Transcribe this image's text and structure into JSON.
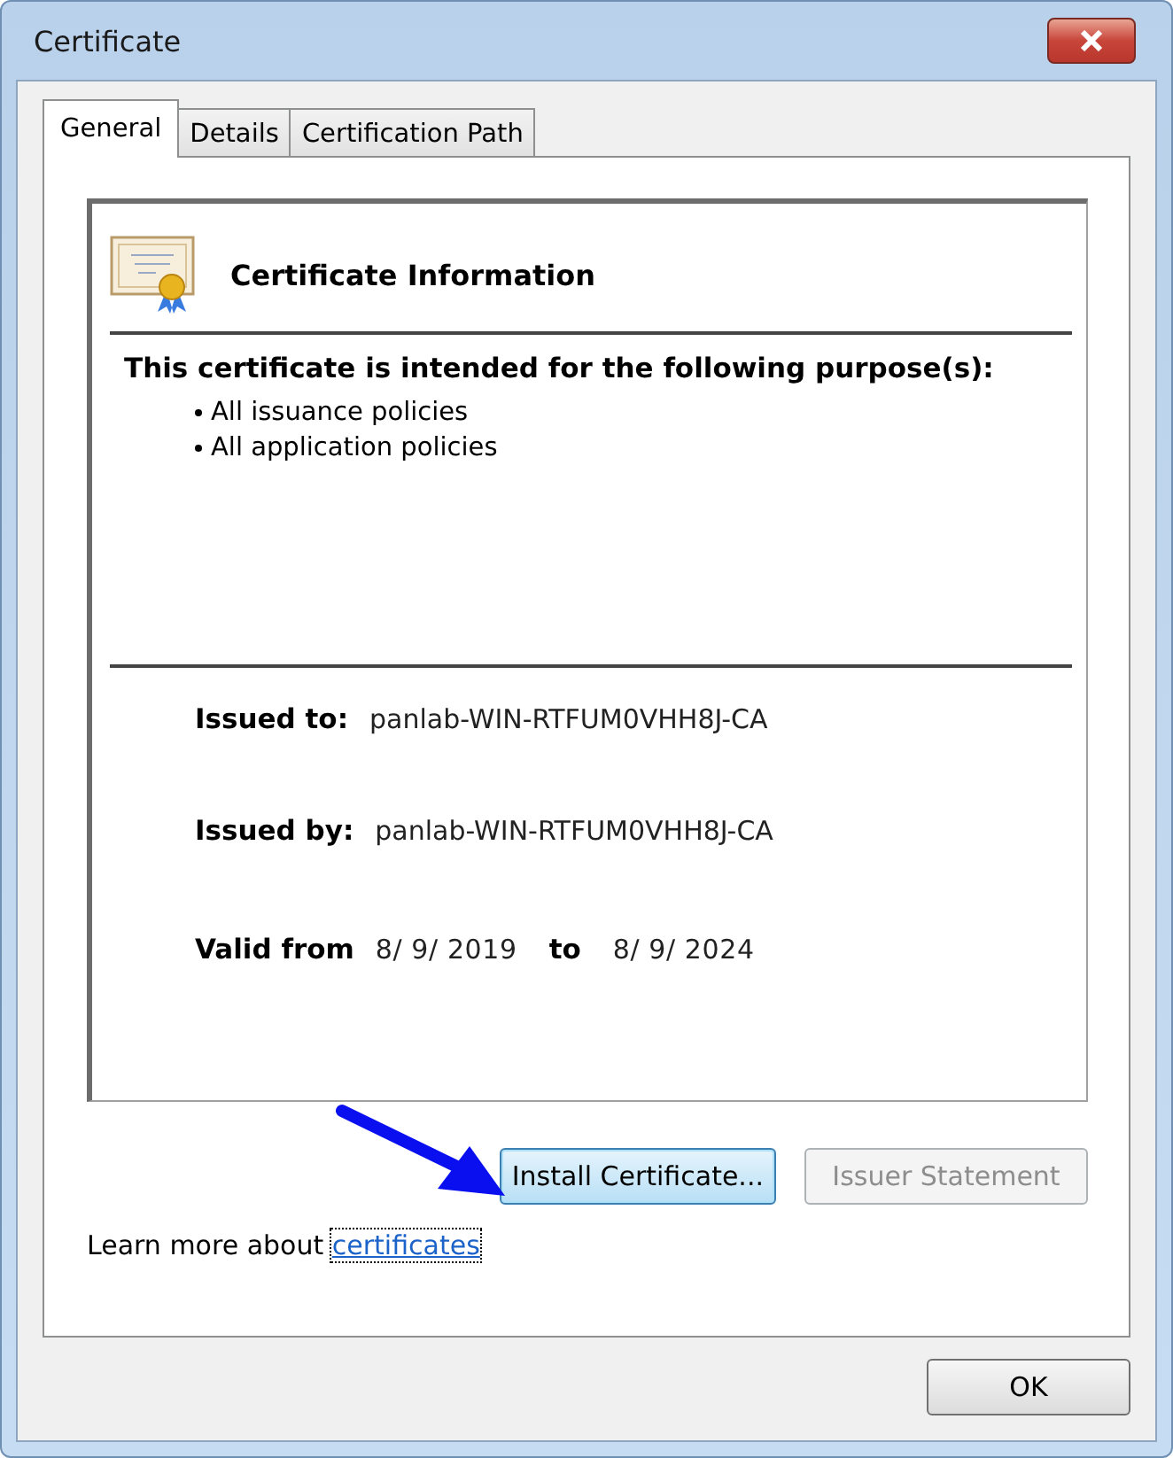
{
  "window": {
    "title": "Certificate"
  },
  "tabs": [
    {
      "label": "General",
      "selected": true
    },
    {
      "label": "Details",
      "selected": false
    },
    {
      "label": "Certification Path",
      "selected": false
    }
  ],
  "info": {
    "heading": "Certificate Information",
    "purpose_title": "This certificate is intended for the following purpose(s):",
    "purposes": [
      "All issuance policies",
      "All application policies"
    ],
    "issued_to_label": "Issued to:",
    "issued_to": "panlab-WIN-RTFUM0VHH8J-CA",
    "issued_by_label": "Issued by:",
    "issued_by": "panlab-WIN-RTFUM0VHH8J-CA",
    "valid_from_label": "Valid from",
    "valid_from": "8/ 9/ 2019",
    "to_label": "to",
    "valid_to": "8/ 9/ 2024"
  },
  "buttons": [
    {
      "label": "Install Certificate...",
      "disabled": false,
      "focused": true
    },
    {
      "label": "Issuer Statement",
      "disabled": true,
      "focused": false
    }
  ],
  "learn_more": {
    "text": "Learn more about",
    "link": "certificates"
  },
  "footer_button": {
    "label": "OK"
  }
}
